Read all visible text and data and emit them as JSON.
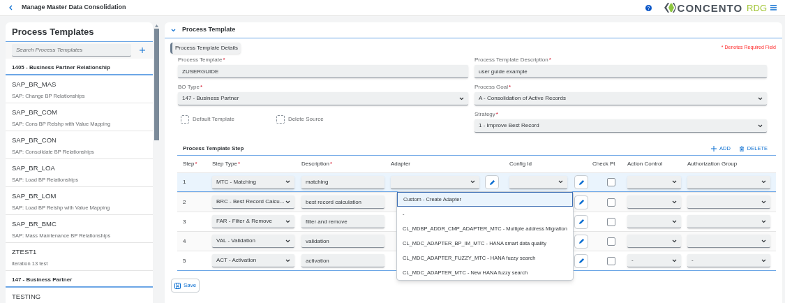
{
  "header": {
    "title": "Manage Master Data Consolidation",
    "logo": {
      "name": "CONCENTO",
      "suffix": "RDG"
    }
  },
  "sidebar": {
    "title": "Process Templates",
    "search": {
      "placeholder": "Search Process Templates"
    },
    "groups": [
      {
        "title": "1405 - Business Partner Relationship",
        "items": [
          {
            "name": "SAP_BR_MAS",
            "description": "SAP: Change BP Relationships"
          },
          {
            "name": "SAP_BR_COM",
            "description": "SAP: Cons BP Relshp with Value Mapping"
          },
          {
            "name": "SAP_BR_CON",
            "description": "SAP: Consolidate BP Relationships"
          },
          {
            "name": "SAP_BR_LOA",
            "description": "SAP: Load BP Relationships"
          },
          {
            "name": "SAP_BR_LOM",
            "description": "SAP: Load BP Relshp with Value Mapping"
          },
          {
            "name": "SAP_BR_BMC",
            "description": "SAP: Mass Maintenance BP Relationships"
          },
          {
            "name": "ZTEST1",
            "description": "iteration 13 test"
          }
        ]
      },
      {
        "title": "147 - Business Partner",
        "items": [
          {
            "name": "TESTING"
          }
        ]
      }
    ]
  },
  "panel": {
    "title": "Process Template",
    "expanded": true,
    "tab": "Process Template Details",
    "required_note": "* Denotes Required Field",
    "left_fields": [
      {
        "kind": "input",
        "label": "Process Template",
        "required_mark": "*",
        "value": "ZUSERGUIDE"
      },
      {
        "kind": "select",
        "label": "BO Type",
        "required_mark": "*",
        "value": "147 - Business Partner"
      },
      {
        "kind": "checkboxes",
        "items": [
          {
            "label": "Default Template",
            "checked": false
          },
          {
            "label": "Delete Source",
            "checked": false
          }
        ]
      }
    ],
    "right_fields": [
      {
        "kind": "input",
        "label": "Process Template Description",
        "required_mark": "*",
        "value": "user guide example"
      },
      {
        "kind": "select",
        "label": "Process Goal",
        "required_mark": "*",
        "value": "A - Consolidation of Active Records"
      },
      {
        "kind": "select",
        "label": "Strategy",
        "required_mark": "*",
        "value": "1 - Improve Best Record"
      }
    ]
  },
  "steps": {
    "title": "Process Template Step",
    "actions": [
      {
        "kind": "add",
        "label": "ADD"
      },
      {
        "kind": "delete",
        "label": "DELETE"
      }
    ],
    "columns": [
      {
        "label": "Step",
        "required_mark": "*"
      },
      {
        "label": "Step Type",
        "required_mark": "*"
      },
      {
        "label": "Description",
        "required_mark": "*"
      },
      {
        "label": "Adapter"
      },
      {
        "label": "Config Id"
      },
      {
        "label": "Check Pt"
      },
      {
        "label": "Action Control"
      },
      {
        "label": "Authorization Group"
      }
    ],
    "rows": [
      {
        "step": "1",
        "step_type": "MTC - Matching",
        "description": "matching",
        "selected": true,
        "adapter_fields_shown": true,
        "check_pt": false
      },
      {
        "step": "2",
        "step_type": "BRC - Best Record Calcu...",
        "description": "best record calculation",
        "selected": false,
        "adapter_fields_shown": false,
        "check_pt": false
      },
      {
        "step": "3",
        "step_type": "FAR - Filter & Remove",
        "description": "filter and remove",
        "selected": false,
        "adapter_fields_shown": false,
        "check_pt": false
      },
      {
        "step": "4",
        "step_type": "VAL - Validation",
        "description": "validation",
        "selected": false,
        "adapter_fields_shown": false,
        "check_pt": false
      },
      {
        "step": "5",
        "step_type": "ACT - Activation",
        "description": "activation",
        "selected": false,
        "adapter_fields_shown": false,
        "check_pt": false,
        "action_control": "-",
        "authorization_group": "-"
      }
    ],
    "adapter_dropdown": {
      "options": [
        {
          "label": "Custom - Create Adapter",
          "selected": true
        },
        {
          "label": "-",
          "selected": false
        },
        {
          "label": "CL_MDBP_ADDR_CMP_ADAPTER_MTC - Multiple address Migration",
          "selected": false
        },
        {
          "label": "CL_MDC_ADAPTER_BP_IM_MTC - HANA smart data quality",
          "selected": false
        },
        {
          "label": "CL_MDC_ADAPTER_FUZZY_MTC - HANA fuzzy search",
          "selected": false
        },
        {
          "label": "CL_MDC_ADAPTER_MTC - New HANA fuzzy search",
          "selected": false
        }
      ]
    }
  },
  "save_button": {
    "label": "Save"
  }
}
